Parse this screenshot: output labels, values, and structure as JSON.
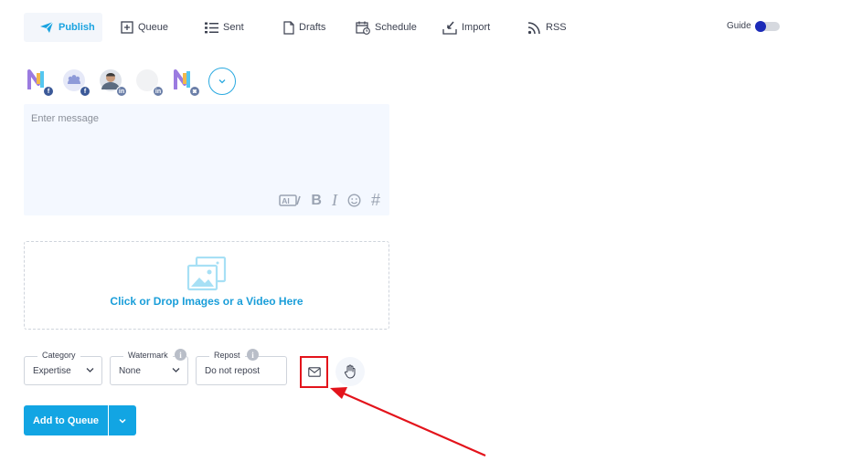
{
  "nav": {
    "items": [
      {
        "id": "publish",
        "label": "Publish",
        "icon": "paper-plane-icon"
      },
      {
        "id": "queue",
        "label": "Queue",
        "icon": "add-square-icon"
      },
      {
        "id": "sent",
        "label": "Sent",
        "icon": "list-icon"
      },
      {
        "id": "drafts",
        "label": "Drafts",
        "icon": "document-icon"
      },
      {
        "id": "schedule",
        "label": "Schedule",
        "icon": "calendar-clock-icon"
      },
      {
        "id": "import",
        "label": "Import",
        "icon": "import-icon"
      },
      {
        "id": "rss",
        "label": "RSS",
        "icon": "rss-icon"
      }
    ],
    "active": "publish"
  },
  "guide": {
    "label": "Guide",
    "enabled": true
  },
  "accounts": [
    {
      "network": "facebook",
      "badge": "f",
      "badge_color": "#3b5998"
    },
    {
      "network": "facebook-group",
      "badge": "f",
      "badge_color": "#3b5998"
    },
    {
      "network": "linkedin",
      "badge": "in",
      "badge_color": "#6b7fa8"
    },
    {
      "network": "linkedin",
      "badge": "in",
      "badge_color": "#6b7fa8"
    },
    {
      "network": "instagram",
      "badge": "◙",
      "badge_color": "#6b7fa8"
    }
  ],
  "message": {
    "placeholder": "Enter message"
  },
  "toolbar": {
    "ai_label": "AI",
    "bold_label": "B",
    "italic_label": "I",
    "hashtag_label": "#"
  },
  "dropzone": {
    "label": "Click or Drop Images or a Video Here"
  },
  "fields": {
    "category": {
      "label": "Category",
      "value": "Expertise"
    },
    "watermark": {
      "label": "Watermark",
      "value": "None"
    },
    "repost": {
      "label": "Repost",
      "value": "Do not repost"
    }
  },
  "info_glyph": "i",
  "add_queue": {
    "label": "Add to Queue"
  },
  "colors": {
    "accent": "#12a5e3",
    "highlight": "#e3131b",
    "toggle": "#1c2bb8"
  }
}
